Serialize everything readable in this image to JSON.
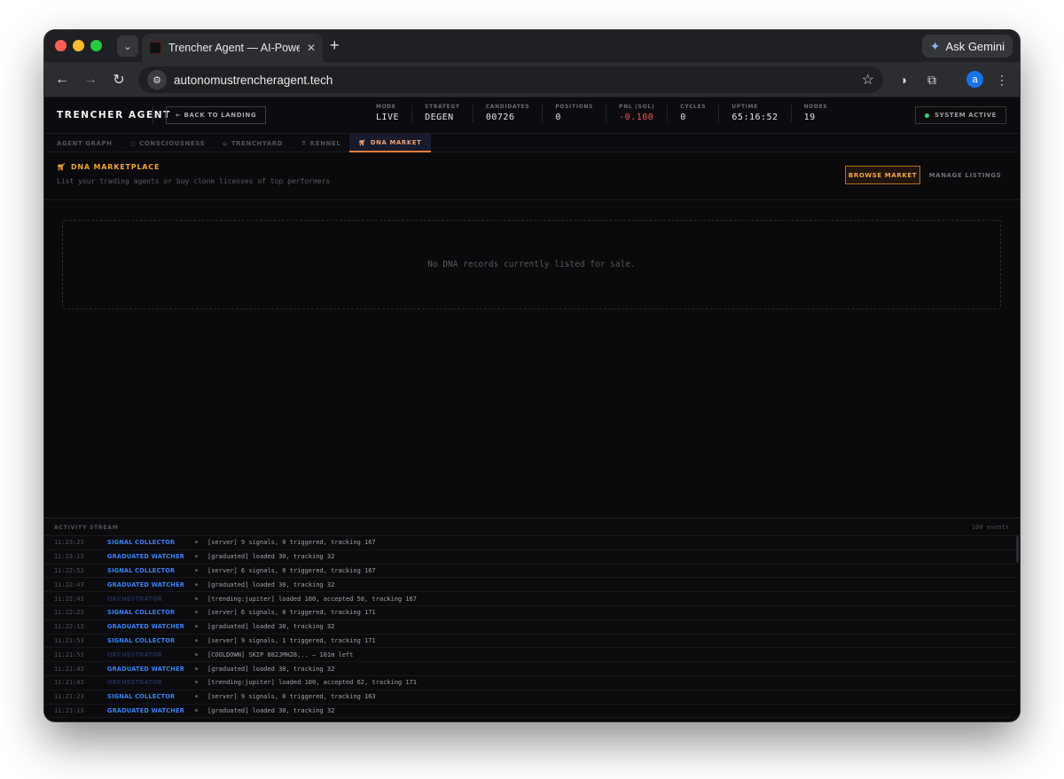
{
  "browser": {
    "tab_title": "Trencher Agent — AI-Powered",
    "url": "autonomustrencheragent.tech",
    "gemini_label": "Ask Gemini",
    "avatar_letter": "a"
  },
  "header": {
    "logo": "TRENCHER AGENT",
    "back_label": "← BACK TO LANDING",
    "stats": [
      {
        "label": "MODE",
        "value": "LIVE"
      },
      {
        "label": "STRATEGY",
        "value": "DEGEN"
      },
      {
        "label": "CANDIDATES",
        "value": "00726"
      },
      {
        "label": "POSITIONS",
        "value": "0"
      },
      {
        "label": "PNL (SOL)",
        "value": "-0.100"
      },
      {
        "label": "CYCLES",
        "value": "0"
      },
      {
        "label": "UPTIME",
        "value": "65:16:52"
      },
      {
        "label": "NODES",
        "value": "19"
      }
    ],
    "system_status": "SYSTEM ACTIVE"
  },
  "tabs": [
    {
      "label": "AGENT GRAPH"
    },
    {
      "label": "CONSCIOUSNESS"
    },
    {
      "label": "TRENCHYARD"
    },
    {
      "label": "KENNEL"
    },
    {
      "label": "DNA MARKET"
    }
  ],
  "market": {
    "title": "DNA MARKETPLACE",
    "subtitle": "List your trading agents or buy clone licenses of top performers",
    "browse_label": "BROWSE MARKET",
    "manage_label": "MANAGE LISTINGS",
    "empty_text": "No DNA records currently listed for sale."
  },
  "activity": {
    "title": "ACTIVITY STREAM",
    "count": "100 events",
    "rows": [
      {
        "time": "11:23:23",
        "source": "SIGNAL COLLECTOR",
        "message": "[server] 9 signals, 0 triggered, tracking 167"
      },
      {
        "time": "11:23:13",
        "source": "GRADUATED WATCHER",
        "message": "[graduated] loaded 30, tracking 32"
      },
      {
        "time": "11:22:53",
        "source": "SIGNAL COLLECTOR",
        "message": "[server] 6 signals, 0 triggered, tracking 167"
      },
      {
        "time": "11:22:43",
        "source": "GRADUATED WATCHER",
        "message": "[graduated] loaded 30, tracking 32"
      },
      {
        "time": "11:22:43",
        "source": "ORCHESTRATOR",
        "message": "[trending:jupiter] loaded 100, accepted 58, tracking 167"
      },
      {
        "time": "11:22:23",
        "source": "SIGNAL COLLECTOR",
        "message": "[server] 6 signals, 0 triggered, tracking 171"
      },
      {
        "time": "11:22:13",
        "source": "GRADUATED WATCHER",
        "message": "[graduated] loaded 30, tracking 32"
      },
      {
        "time": "11:21:53",
        "source": "SIGNAL COLLECTOR",
        "message": "[server] 9 signals, 1 triggered, tracking 171"
      },
      {
        "time": "11:21:53",
        "source": "ORCHESTRATOR",
        "message": "[COOLDOWN] SKIP 882JMH28... — 101m left"
      },
      {
        "time": "11:21:43",
        "source": "GRADUATED WATCHER",
        "message": "[graduated] loaded 30, tracking 32"
      },
      {
        "time": "11:21:43",
        "source": "ORCHESTRATOR",
        "message": "[trending:jupiter] loaded 100, accepted 62, tracking 171"
      },
      {
        "time": "11:21:23",
        "source": "SIGNAL COLLECTOR",
        "message": "[server] 9 signals, 0 triggered, tracking 163"
      },
      {
        "time": "11:21:13",
        "source": "GRADUATED WATCHER",
        "message": "[graduated] loaded 30, tracking 32"
      }
    ]
  }
}
